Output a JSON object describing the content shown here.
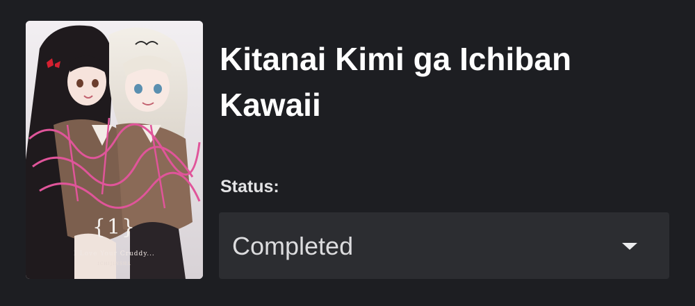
{
  "manga": {
    "title": "Kitanai Kimi ga Ichiban Kawaii",
    "cover": {
      "volume_mark": "{1}",
      "subtitle": "I Love Your Cruddy...",
      "author": "ICHIJINSHA"
    }
  },
  "status": {
    "label": "Status:",
    "selected": "Completed",
    "dropdown_icon": "chevron-down-icon"
  },
  "colors": {
    "background": "#1d1e22",
    "field_background": "#2c2d31",
    "title_text": "#ffffff",
    "accent_pink": "#e0559a"
  }
}
